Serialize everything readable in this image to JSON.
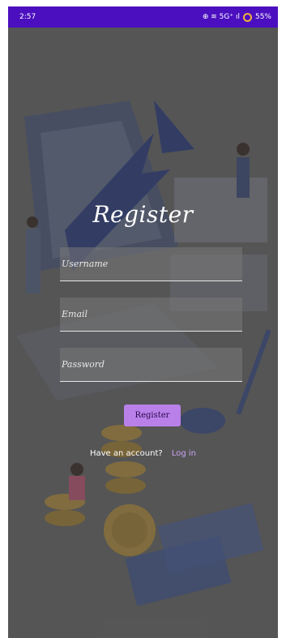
{
  "status": {
    "time": "2:57",
    "icons": "⊕ ≋ 5G⁺ ıl",
    "battery": "55%"
  },
  "form": {
    "title": "Register",
    "username_placeholder": "Username",
    "email_placeholder": "Email",
    "password_placeholder": "Password",
    "register_label": "Register",
    "have_account": "Have an account?",
    "login_label": "Log in"
  },
  "colors": {
    "status_bar": "#4b0fbf",
    "button": "#b980ea",
    "link": "#c9a2f2"
  }
}
